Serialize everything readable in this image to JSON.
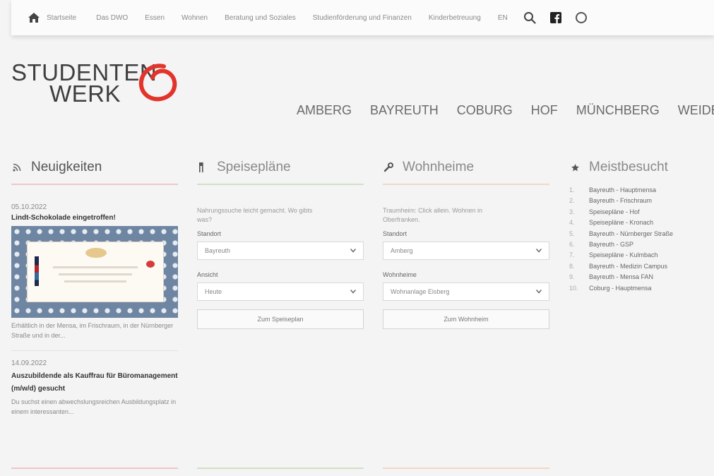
{
  "topnav": {
    "home_label": "Startseite",
    "links": [
      "Das DWO",
      "Essen",
      "Wohnen",
      "Beratung und Soziales",
      "Studienförderung und Finanzen",
      "Kinderbetreuung"
    ],
    "lang_label": "EN"
  },
  "logo": {
    "line1": "STUDENTEN",
    "line2": "WERK",
    "accent_color": "#e2342b"
  },
  "cities": [
    "AMBERG",
    "BAYREUTH",
    "COBURG",
    "HOF",
    "MÜNCHBERG",
    "WEIDEN"
  ],
  "news": {
    "heading": "Neuigkeiten",
    "items": [
      {
        "date": "05.10.2022",
        "title": "Lindt-Schokolade eingetroffen!",
        "teaser": "Erhältlich in der Mensa, im Frischraum, in der Nürnberger Straße und in der..."
      },
      {
        "date": "14.09.2022",
        "title": "Auszubildende als Kauffrau für Büromanagement (m/w/d) gesucht",
        "teaser": "Du suchst einen abwechslungsreichen Ausbildungsplatz in einem interessanten..."
      }
    ]
  },
  "menus": {
    "heading": "Speisepläne",
    "intro": "Nahrungssuche leicht gemacht. Wo gibts was?",
    "location_label": "Standort",
    "location_value": "Bayreuth",
    "view_label": "Ansicht",
    "view_value": "Heute",
    "button_label": "Zum Speiseplan"
  },
  "dorms": {
    "heading": "Wohnheime",
    "intro": "Traumheim: Click allein. Wohnen in Oberfranken.",
    "location_label": "Standort",
    "location_value": "Amberg",
    "dorm_label": "Wohnheime",
    "dorm_value": "Wohnanlage Eisberg",
    "button_label": "Zum Wohnheim"
  },
  "popular": {
    "heading": "Meistbesucht",
    "items": [
      {
        "num": "1.",
        "label": "Bayreuth - Hauptmensa"
      },
      {
        "num": "2.",
        "label": "Bayreuth - Frischraum"
      },
      {
        "num": "3.",
        "label": "Speisepläne - Hof"
      },
      {
        "num": "4.",
        "label": "Speisepläne - Kronach"
      },
      {
        "num": "5.",
        "label": "Bayreuth - Nürnberger Straße"
      },
      {
        "num": "6.",
        "label": "Bayreuth - GSP"
      },
      {
        "num": "7.",
        "label": "Speisepläne - Kulmbach"
      },
      {
        "num": "8.",
        "label": "Bayreuth - Medizin Campus"
      },
      {
        "num": "9.",
        "label": "Bayreuth - Mensa FAN"
      },
      {
        "num": "10.",
        "label": "Coburg - Hauptmensa"
      }
    ]
  }
}
